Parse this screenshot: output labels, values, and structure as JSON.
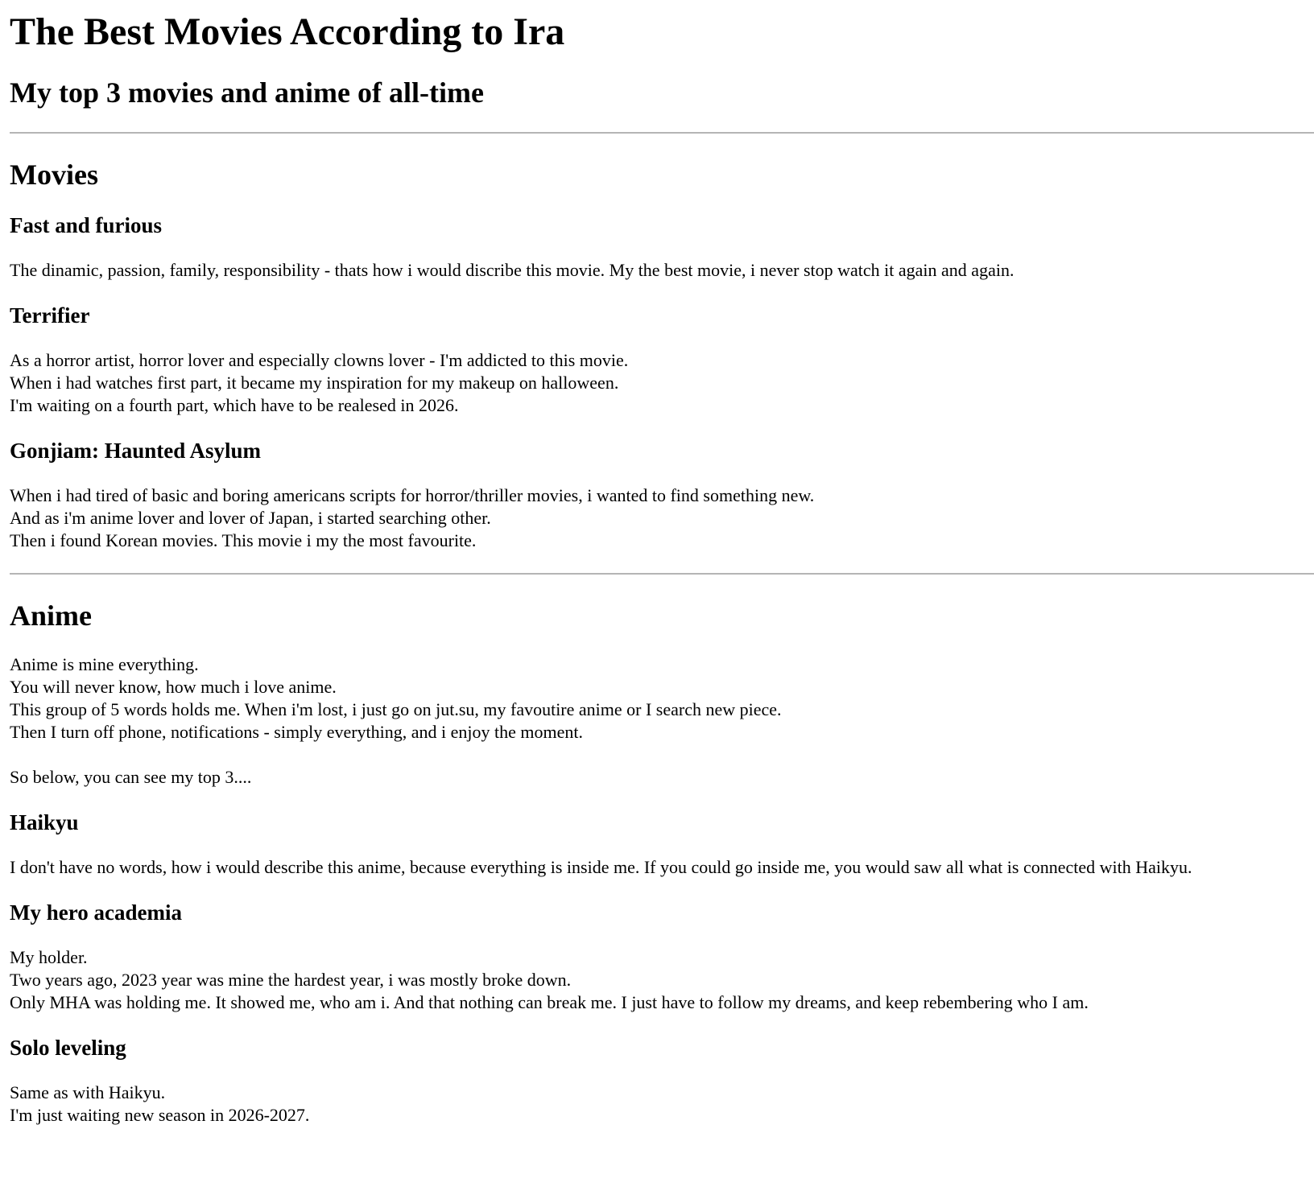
{
  "page_title": "The Best Movies According to Ira",
  "subtitle": "My top 3 movies and anime of all-time",
  "movies": {
    "heading": "Movies",
    "items": [
      {
        "title": "Fast and furious",
        "text": "The dinamic, passion, family, responsibility - thats how i would discribe this movie. My the best movie, i never stop watch it again and again."
      },
      {
        "title": "Terrifier",
        "text": "As a horror artist, horror lover and especially clowns lover - I'm addicted to this movie.\nWhen i had watches first part, it became my inspiration for my makeup on halloween.\nI'm waiting on a fourth part, which have to be realesed in 2026."
      },
      {
        "title": "Gonjiam: Haunted Asylum",
        "text": "When i had tired of basic and boring americans scripts for horror/thriller movies, i wanted to find something new.\nAnd as i'm anime lover and lover of Japan, i started searching other.\nThen i found Korean movies. This movie i my the most favourite."
      }
    ]
  },
  "anime": {
    "heading": "Anime",
    "intro": "Anime is mine everything.\nYou will never know, how much i love anime.\nThis group of 5 words holds me. When i'm lost, i just go on jut.su, my favoutire anime or I search new piece.\nThen I turn off phone, notifications - simply everything, and i enjoy the moment.",
    "lead": "So below, you can see my top 3....",
    "items": [
      {
        "title": "Haikyu",
        "text": "I don't have no words, how i would describe this anime, because everything is inside me. If you could go inside me, you would saw all what is connected with Haikyu."
      },
      {
        "title": "My hero academia",
        "text": "My holder.\nTwo years ago, 2023 year was mine the hardest year, i was mostly broke down.\nOnly MHA was holding me. It showed me, who am i. And that nothing can break me. I just have to follow my dreams, and keep rebembering who I am."
      },
      {
        "title": "Solo leveling",
        "text": "Same as with Haikyu.\nI'm just waiting new season in 2026-2027."
      }
    ]
  }
}
